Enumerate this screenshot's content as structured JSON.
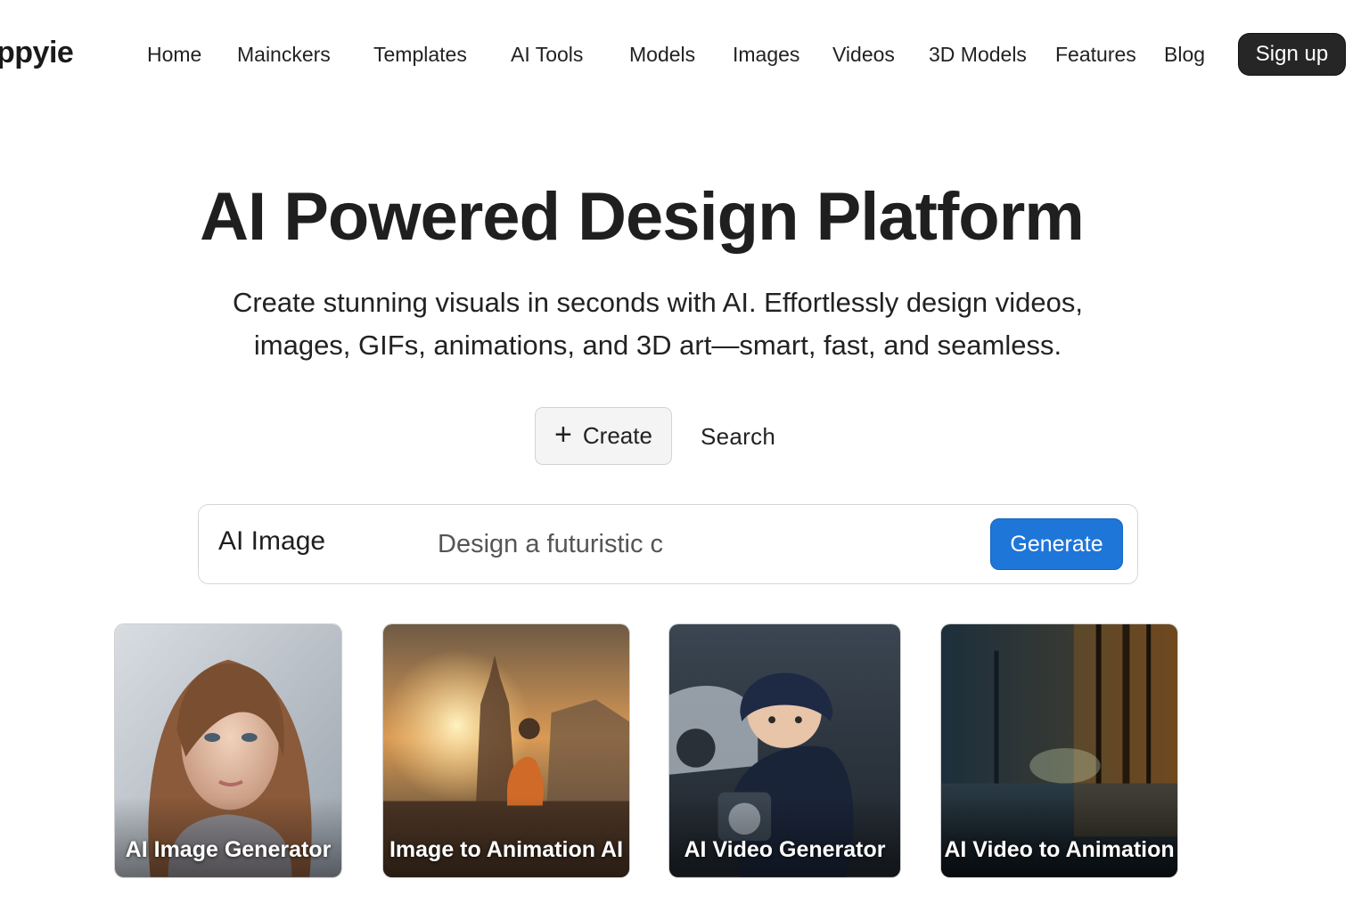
{
  "brand": {
    "logo_text": "ppyie"
  },
  "nav": {
    "links": [
      "Home",
      "Mainckers",
      "Templates",
      "AI Tools",
      "Models",
      "Images",
      "Videos",
      "3D Models",
      "Features",
      "Blog"
    ],
    "signup_label": "Sign up"
  },
  "hero": {
    "title": "AI Powered Design Platform",
    "subtitle_line1": "Create stunning visuals in seconds with AI. Effortlessly design videos,",
    "subtitle_line2": "images, GIFs, animations, and 3D art—smart, fast, and seamless."
  },
  "actions": {
    "create_label": "Create",
    "create_icon": "plus-icon",
    "search_label": "Search"
  },
  "prompt": {
    "mode_label": "AI Image",
    "input_value": "Design a futuristic c",
    "generate_label": "Generate",
    "accent_color": "#1f76d9"
  },
  "cards": [
    {
      "label": "AI Image Generator"
    },
    {
      "label": "Image to Animation AI"
    },
    {
      "label": "AI Video Generator"
    },
    {
      "label": "AI Video to Animation"
    }
  ]
}
